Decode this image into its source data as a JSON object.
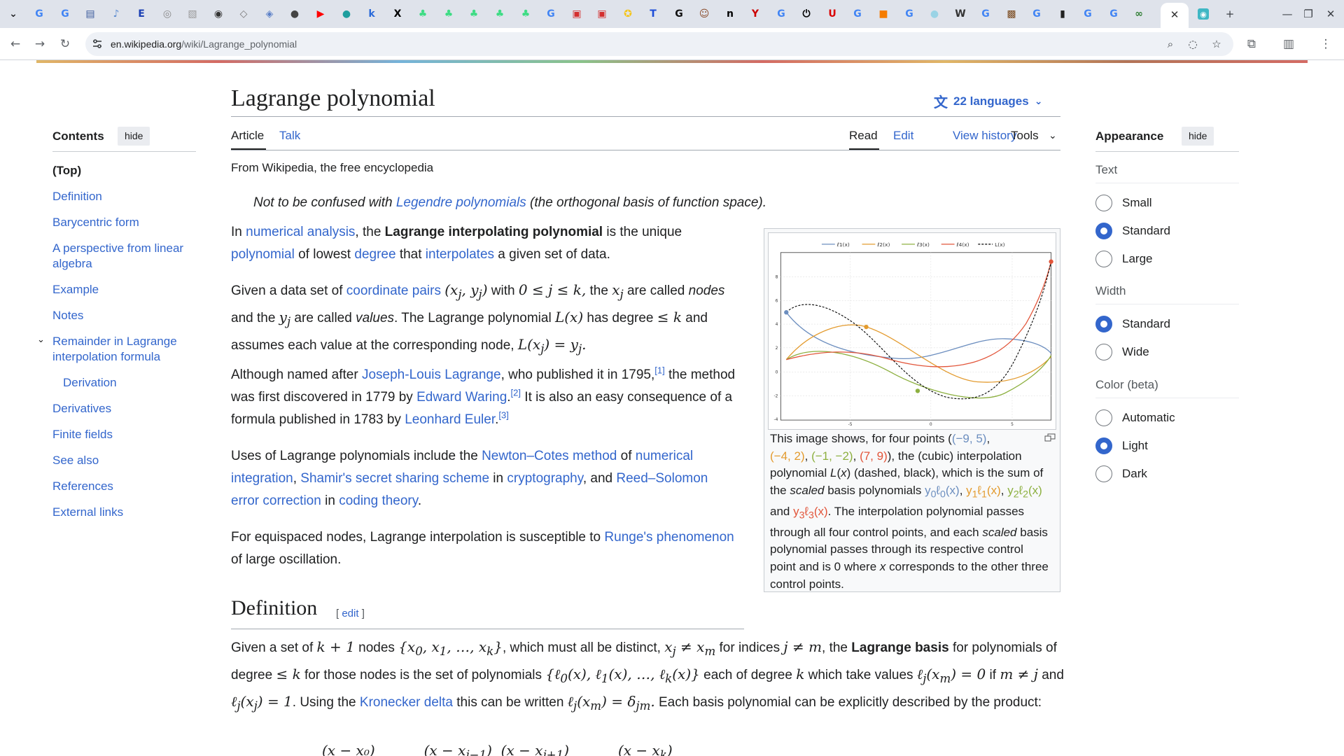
{
  "browser": {
    "tabs": [
      {
        "icon": "chevron-down-icon",
        "glyph": "⌄",
        "color": "#202124"
      },
      {
        "icon": "google-icon",
        "glyph": "G",
        "color": "#4285f4"
      },
      {
        "icon": "google-icon",
        "glyph": "G",
        "color": "#4285f4"
      },
      {
        "icon": "docs-icon",
        "glyph": "▤",
        "color": "#3a5a9c"
      },
      {
        "icon": "page-icon",
        "glyph": "♪",
        "color": "#5b8bd0"
      },
      {
        "icon": "e-icon",
        "glyph": "E",
        "color": "#1a3fb3"
      },
      {
        "icon": "attachment-icon",
        "glyph": "◎",
        "color": "#888"
      },
      {
        "icon": "image-icon",
        "glyph": "▧",
        "color": "#999"
      },
      {
        "icon": "compass-icon",
        "glyph": "◉",
        "color": "#333"
      },
      {
        "icon": "shield-icon",
        "glyph": "◇",
        "color": "#777"
      },
      {
        "icon": "shield-icon",
        "glyph": "◈",
        "color": "#5a7fc7"
      },
      {
        "icon": "globe-icon",
        "glyph": "●",
        "color": "#444"
      },
      {
        "icon": "youtube-icon",
        "glyph": "▶",
        "color": "#ff0000"
      },
      {
        "icon": "circle-icon",
        "glyph": "●",
        "color": "#1e9e9e"
      },
      {
        "icon": "k-icon",
        "glyph": "k",
        "color": "#2a6ad9"
      },
      {
        "icon": "x-icon",
        "glyph": "X",
        "color": "#000"
      },
      {
        "icon": "android-icon",
        "glyph": "♣",
        "color": "#3ddc84"
      },
      {
        "icon": "android-icon",
        "glyph": "♣",
        "color": "#3ddc84"
      },
      {
        "icon": "android-icon",
        "glyph": "♣",
        "color": "#3ddc84"
      },
      {
        "icon": "android-icon",
        "glyph": "♣",
        "color": "#3ddc84"
      },
      {
        "icon": "android-icon",
        "glyph": "♣",
        "color": "#3ddc84"
      },
      {
        "icon": "google-icon",
        "glyph": "G",
        "color": "#4285f4"
      },
      {
        "icon": "news-icon",
        "glyph": "▣",
        "color": "#d32f2f"
      },
      {
        "icon": "news-icon",
        "glyph": "▣",
        "color": "#d32f2f"
      },
      {
        "icon": "ribbon-icon",
        "glyph": "✪",
        "color": "#f5c518"
      },
      {
        "icon": "t-icon",
        "glyph": "T",
        "color": "#1d4ed8"
      },
      {
        "icon": "g-icon",
        "glyph": "G",
        "color": "#111"
      },
      {
        "icon": "avatar-icon",
        "glyph": "☺",
        "color": "#8a4b2a"
      },
      {
        "icon": "n-icon",
        "glyph": "n",
        "color": "#000"
      },
      {
        "icon": "y-icon",
        "glyph": "Y",
        "color": "#c00"
      },
      {
        "icon": "google-icon",
        "glyph": "G",
        "color": "#4285f4"
      },
      {
        "icon": "power-icon",
        "glyph": "⏻",
        "color": "#000"
      },
      {
        "icon": "u-icon",
        "glyph": "U",
        "color": "#d90000"
      },
      {
        "icon": "google-icon",
        "glyph": "G",
        "color": "#4285f4"
      },
      {
        "icon": "orange-icon",
        "glyph": "■",
        "color": "#f57c00"
      },
      {
        "icon": "google-icon",
        "glyph": "G",
        "color": "#4285f4"
      },
      {
        "icon": "chat-icon",
        "glyph": "●",
        "color": "#9ad3e5"
      },
      {
        "icon": "wikipedia-icon",
        "glyph": "W",
        "color": "#333"
      },
      {
        "icon": "google-icon",
        "glyph": "G",
        "color": "#4285f4"
      },
      {
        "icon": "photo-icon",
        "glyph": "▩",
        "color": "#7a4a1e"
      },
      {
        "icon": "google-icon",
        "glyph": "G",
        "color": "#4285f4"
      },
      {
        "icon": "book-icon",
        "glyph": "▮",
        "color": "#222"
      },
      {
        "icon": "google-icon",
        "glyph": "G",
        "color": "#4285f4"
      },
      {
        "icon": "google-icon",
        "glyph": "G",
        "color": "#4285f4"
      },
      {
        "icon": "link-icon",
        "glyph": "∞",
        "color": "#2e7d32"
      }
    ],
    "active_tab_close": "✕",
    "extra_tab_icon": "◉",
    "new_tab": "+",
    "url_host": "en.wikipedia.org",
    "url_path": "/wiki/Lagrange_polynomial"
  },
  "article": {
    "title": "Lagrange polynomial",
    "languages": "22 languages",
    "tabs": {
      "article": "Article",
      "talk": "Talk",
      "read": "Read",
      "edit": "Edit",
      "history": "View history",
      "tools": "Tools"
    },
    "from": "From Wikipedia, the free encyclopedia",
    "hatnote": {
      "pre": "Not to be confused with ",
      "link": "Legendre polynomials",
      "post": " (the orthogonal basis of function space)."
    },
    "def_heading": "Definition",
    "def_edit": "edit"
  },
  "toc": {
    "heading": "Contents",
    "hide": "hide",
    "items": [
      "(Top)",
      "Definition",
      "Barycentric form",
      "A perspective from linear algebra",
      "Example",
      "Notes",
      "Remainder in Lagrange interpolation formula",
      "Derivation",
      "Derivatives",
      "Finite fields",
      "See also",
      "References",
      "External links"
    ]
  },
  "appearance": {
    "heading": "Appearance",
    "hide": "hide",
    "text_label": "Text",
    "text_options": [
      "Small",
      "Standard",
      "Large"
    ],
    "text_selected": "Standard",
    "width_label": "Width",
    "width_options": [
      "Standard",
      "Wide"
    ],
    "width_selected": "Standard",
    "color_label": "Color (beta)",
    "color_options": [
      "Automatic",
      "Light",
      "Dark"
    ],
    "color_selected": "Light"
  },
  "figure": {
    "legend": [
      "ℓ1(x)",
      "ℓ2(x)",
      "ℓ3(x)",
      "ℓ4(x)",
      "L(x)"
    ],
    "x_ticks": [
      "-5",
      "0",
      "5"
    ],
    "y_ticks": [
      "8",
      "6",
      "4",
      "2",
      "0",
      "-2",
      "-4"
    ],
    "colors": {
      "l0": "#6c8ebf",
      "l1": "#e39b2f",
      "l2": "#8db040",
      "l3": "#e2553a",
      "L": "#000000"
    }
  },
  "colors": {
    "link": "#3366cc",
    "text": "#202122",
    "accent": "#3366cc"
  }
}
